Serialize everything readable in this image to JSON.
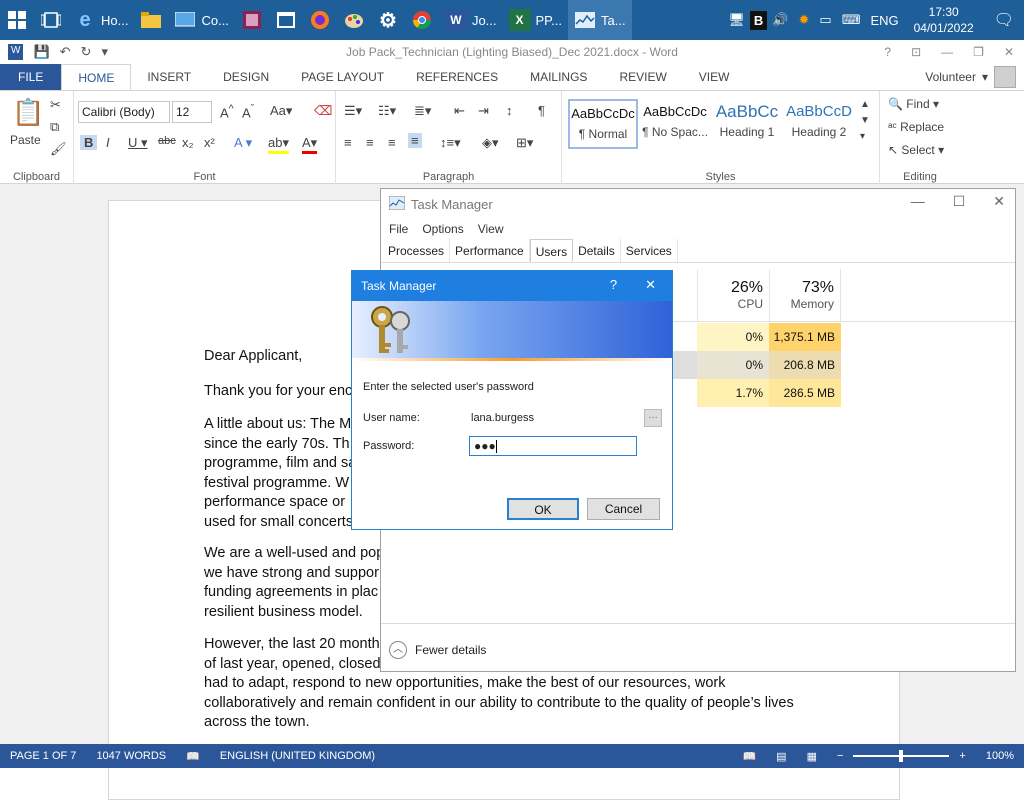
{
  "taskbar": {
    "items": [
      {
        "label": "Ho...",
        "icon": "ie-icon"
      },
      {
        "label": "",
        "icon": "folder-icon"
      },
      {
        "label": "Co...",
        "icon": "remote-icon"
      },
      {
        "label": "",
        "icon": "winrar-icon"
      },
      {
        "label": "",
        "icon": "window-icon"
      },
      {
        "label": "",
        "icon": "firefox-icon"
      },
      {
        "label": "",
        "icon": "paint-icon"
      },
      {
        "label": "",
        "icon": "gear-icon"
      },
      {
        "label": "",
        "icon": "chrome-icon"
      },
      {
        "label": "Jo...",
        "icon": "word-icon"
      },
      {
        "label": "PP...",
        "icon": "excel-icon"
      },
      {
        "label": "Ta...",
        "icon": "task-manager-icon"
      }
    ],
    "tray_lang": "ENG",
    "time": "17:30",
    "date": "04/01/2022"
  },
  "word": {
    "title": "Job Pack_Technician (Lighting Biased)_Dec 2021.docx - Word",
    "tabs": [
      "FILE",
      "HOME",
      "INSERT",
      "DESIGN",
      "PAGE LAYOUT",
      "REFERENCES",
      "MAILINGS",
      "REVIEW",
      "VIEW"
    ],
    "user": "Volunteer",
    "ribbon": {
      "paste": "Paste",
      "clipboard": "Clipboard",
      "font_name": "Calibri (Body)",
      "font_size": "12",
      "font": "Font",
      "paragraph": "Paragraph",
      "styles": "Styles",
      "editing": "Editing",
      "style_items": [
        {
          "preview": "AaBbCcDc",
          "name": "¶ Normal"
        },
        {
          "preview": "AaBbCcDc",
          "name": "¶ No Spac..."
        },
        {
          "preview": "AaBbCc",
          "name": "Heading 1"
        },
        {
          "preview": "AaBbCcD",
          "name": "Heading 2"
        }
      ],
      "find": "Find",
      "replace": "Replace",
      "select": "Select"
    },
    "doc": {
      "p1": "Dear Applicant,",
      "p2": "Thank you for your enc",
      "p3": [
        "A little about us: The M",
        "since the early 70s. Th",
        "programme, film and sa",
        "festival programme.  W",
        "performance space or",
        "used for small concerts"
      ],
      "p4": [
        "We are a well-used and pop",
        "we have strong and suppor",
        "funding agreements in plac",
        "resilient business model."
      ],
      "p5": [
        "However, the last 20 month",
        "of last year, opened, closed",
        "had to adapt, respond to new opportunities, make the best of our resources, work",
        "collaboratively and remain confident in our ability to contribute to the quality of people’s lives",
        "across the town."
      ]
    },
    "status": {
      "page": "PAGE 1 OF 7",
      "words": "1047 WORDS",
      "language": "ENGLISH (UNITED KINGDOM)",
      "zoom": "100%"
    }
  },
  "task_manager": {
    "title": "Task Manager",
    "menu": [
      "File",
      "Options",
      "View"
    ],
    "tabs": [
      "Processes",
      "Performance",
      "Users",
      "Details",
      "Services"
    ],
    "cpu_pct": "26%",
    "cpu_label": "CPU",
    "mem_pct": "73%",
    "mem_label": "Memory",
    "rows": [
      {
        "cpu": "0%",
        "mem": "1,375.1 MB"
      },
      {
        "cpu": "0%",
        "mem": "206.8 MB"
      },
      {
        "cpu": "1.7%",
        "mem": "286.5 MB"
      }
    ],
    "fewer_details": "Fewer details"
  },
  "dialog": {
    "title": "Task Manager",
    "help": "?",
    "prompt": "Enter the selected user's password",
    "username_label": "User name:",
    "username": "lana.burgess",
    "password_label": "Password:",
    "password_mask": "●●●",
    "ok": "OK",
    "cancel": "Cancel"
  }
}
